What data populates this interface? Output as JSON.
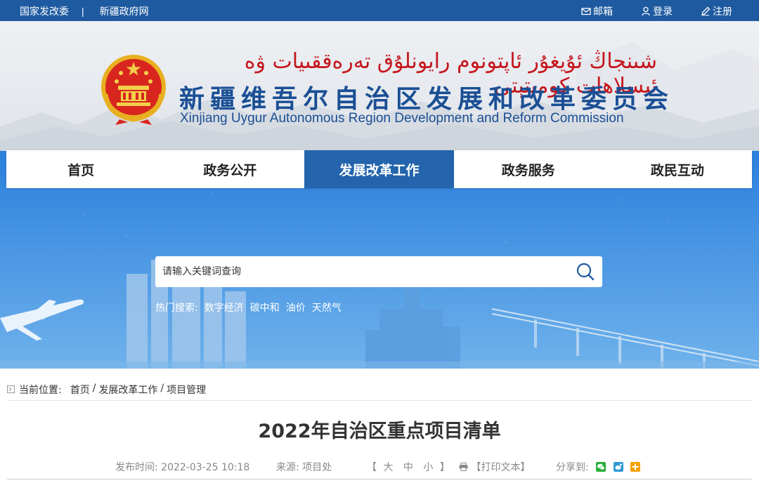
{
  "topbar": {
    "left_links": [
      "国家发改委",
      "新疆政府网"
    ],
    "separator": "|",
    "mail": "邮箱",
    "login": "登录",
    "register": "注册"
  },
  "header": {
    "title_uyghur": "شىنجاڭ ئۇيغۇر ئاپتونوم رايونلۇق تەرەققىيات ۋە ئىسلاھات كومىتېتى",
    "title_cn": "新疆维吾尔自治区发展和改革委员会",
    "title_en": "Xinjiang Uygur Autonomous Region Development and Reform Commission"
  },
  "nav": {
    "items": [
      "首页",
      "政务公开",
      "发展改革工作",
      "政务服务",
      "政民互动"
    ],
    "active_index": 2
  },
  "search": {
    "placeholder": "请输入关键词查询",
    "hot_label": "热门搜索:",
    "hot_terms": [
      "数字经济",
      "碳中和",
      "油价",
      "天然气"
    ]
  },
  "breadcrumb": {
    "label": "当前位置:",
    "items": [
      "首页",
      "发展改革工作",
      "项目管理"
    ],
    "separator": "/"
  },
  "article": {
    "title": "2022年自治区重点项目清单",
    "publish_label": "发布时间:",
    "publish_time": "2022-03-25 10:18",
    "source_label": "来源:",
    "source": "项目处",
    "size_open": "【",
    "size_large": "大",
    "size_medium": "中",
    "size_small": "小",
    "size_close": "】",
    "print_label": "【打印文本】",
    "share_label": "分享到:"
  },
  "colors": {
    "primary_blue": "#1e5aa0",
    "nav_active": "#2364ac",
    "title_red": "#c4161c",
    "share_wechat": "#2aae3c",
    "share_weibo": "#2f9bd6",
    "share_qzone": "#f5a100"
  }
}
